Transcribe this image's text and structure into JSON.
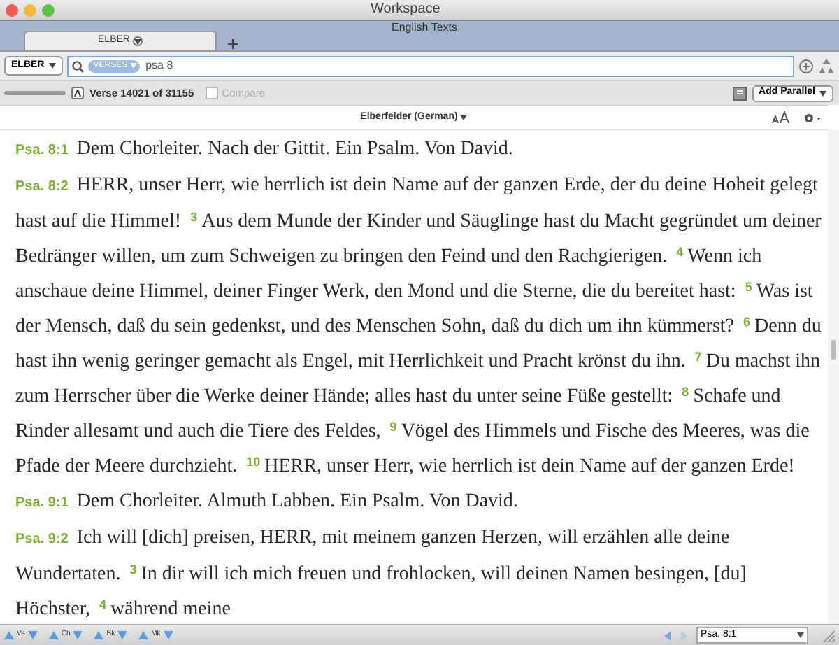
{
  "window": {
    "title": "Workspace",
    "subtitle": "English Texts"
  },
  "tabs": [
    {
      "label": "ELBER",
      "selected": true
    }
  ],
  "toolbar": {
    "module": "ELBER",
    "search_scope": "VERSES",
    "search_value": "psa 8"
  },
  "options_bar": {
    "verse_info": "Verse 14021 of 31155",
    "compare": {
      "label": "Compare",
      "checked": false,
      "disabled": true
    },
    "add_parallel": "Add Parallel"
  },
  "font_size_slider": {
    "level": 1
  },
  "text_header": {
    "title": "Elberfelder (German)"
  },
  "paragraphs": [
    {
      "ref": "Psa. 8:1",
      "text": "Dem Chorleiter. Nach der Gittit. Ein Psalm. Von David."
    },
    {
      "ref": "Psa. 8:2",
      "text": "HERR, unser Herr, wie herrlich ist dein Name auf der ganzen Erde, der du deine Hoheit gelegt hast auf die Himmel!",
      "verses": [
        {
          "number": "3",
          "text": "Aus dem Munde der Kinder und Säuglinge hast du Macht gegründet um deiner Bedränger willen, um zum Schweigen zu bringen den Feind und den Rachgierigen."
        },
        {
          "number": "4",
          "text": "Wenn ich anschaue deine Himmel, deiner Finger Werk, den Mond und die Sterne, die du bereitet hast:"
        },
        {
          "number": "5",
          "text": "Was ist der Mensch, daß du sein gedenkst, und des Menschen Sohn, daß du dich um ihn kümmerst?"
        },
        {
          "number": "6",
          "text": "Denn du hast ihn wenig geringer gemacht als Engel, mit Herrlichkeit und Pracht krönst du ihn."
        },
        {
          "number": "7",
          "text": "Du machst ihn zum Herrscher über die Werke deiner Hände; alles hast du unter seine Füße gestellt:"
        },
        {
          "number": "8",
          "text": "Schafe und Rinder allesamt und auch die Tiere des Feldes,"
        },
        {
          "number": "9",
          "text": "Vögel des Himmels und Fische des Meeres, was die Pfade der Meere durchzieht."
        },
        {
          "number": "10",
          "text": "HERR, unser Herr, wie herrlich ist dein Name auf der ganzen Erde!"
        }
      ]
    },
    {
      "ref": "Psa. 9:1",
      "text": "Dem Chorleiter. Almuth Labben. Ein Psalm. Von David."
    },
    {
      "ref": "Psa. 9:2",
      "text": "Ich will [dich] preisen, HERR, mit meinem ganzen Herzen, will erzählen alle deine Wundertaten.",
      "verses": [
        {
          "number": "3",
          "text": "In dir will ich mich freuen und frohlocken, will deinen Namen besingen, [du] Höchster,"
        },
        {
          "number": "4",
          "text": "während meine"
        }
      ]
    }
  ],
  "bottom_bar": {
    "nav": [
      "Vs",
      "Ch",
      "Bk",
      "Mk"
    ],
    "reference": "Psa. 8:1"
  }
}
